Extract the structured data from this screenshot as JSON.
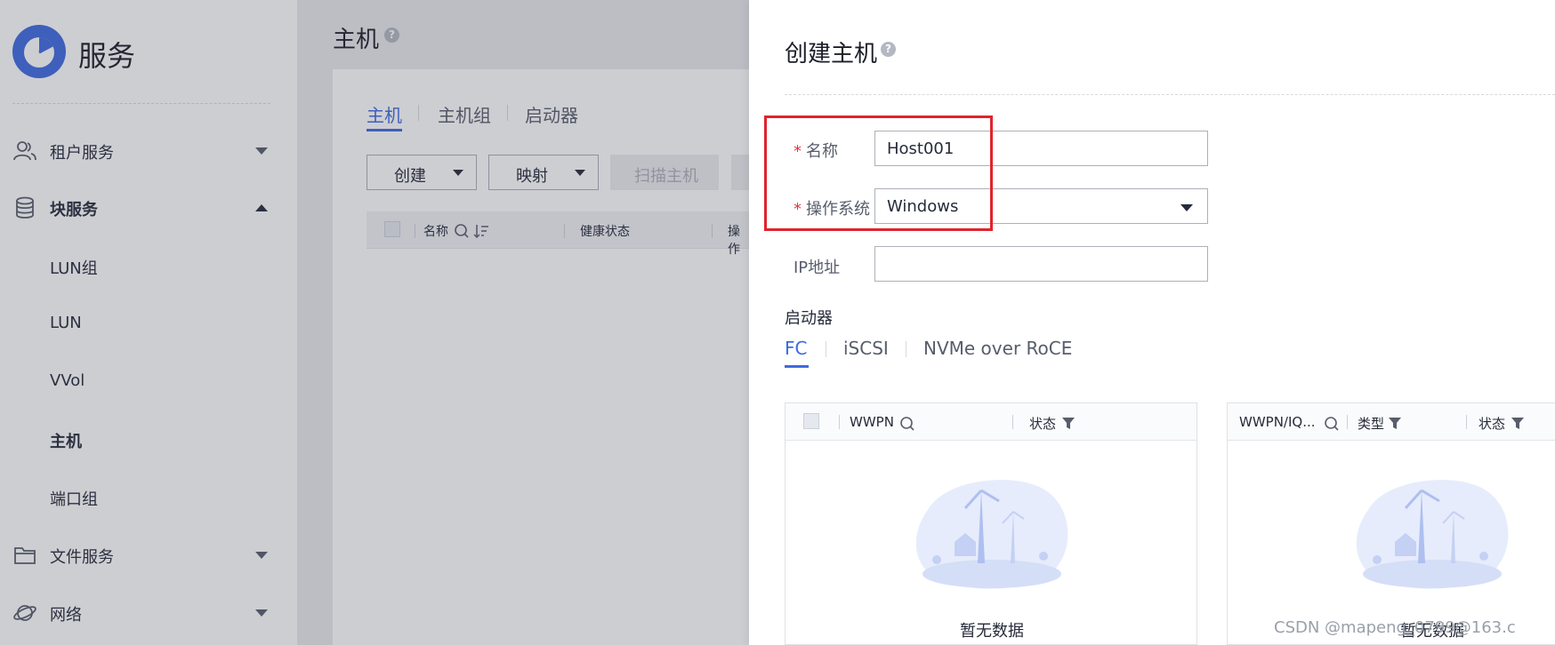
{
  "sidebar": {
    "title": "服务",
    "menu": [
      {
        "label": "租户服务",
        "icon": "users-icon"
      },
      {
        "label": "块服务",
        "icon": "database-icon"
      },
      {
        "label": "文件服务",
        "icon": "folder-icon"
      },
      {
        "label": "网络",
        "icon": "planet-icon"
      }
    ],
    "block_sub_items": [
      "LUN组",
      "LUN",
      "VVol",
      "主机",
      "端口组"
    ],
    "active_item": "主机"
  },
  "host_page": {
    "title": "主机",
    "tabs": [
      "主机",
      "主机组",
      "启动器"
    ],
    "active_tab": "主机",
    "buttons": {
      "create": "创建",
      "map": "映射",
      "scan": "扫描主机"
    },
    "columns": [
      "名称",
      "健康状态",
      "操作"
    ]
  },
  "drawer": {
    "title": "创建主机",
    "name_label": "名称",
    "name_value": "Host001",
    "os_label": "操作系统",
    "os_value": "Windows",
    "ip_label": "IP地址",
    "ip_value": "",
    "initiator_label": "启动器",
    "initiator_tabs": [
      "FC",
      "iSCSI",
      "NVMe over RoCE"
    ],
    "active_initiator_tab": "FC",
    "left_table": {
      "columns": [
        "WWPN",
        "状态"
      ],
      "empty_text": "暂无数据"
    },
    "right_table": {
      "columns": [
        "WWPN/IQ...",
        "类型",
        "状态"
      ],
      "empty_text": "暂无数据"
    }
  },
  "watermark": "CSDN @mapeng_0799@163.c",
  "colors": {
    "accent": "#3e6ae1",
    "required": "#e6343d",
    "highlight": "#e0232e"
  }
}
